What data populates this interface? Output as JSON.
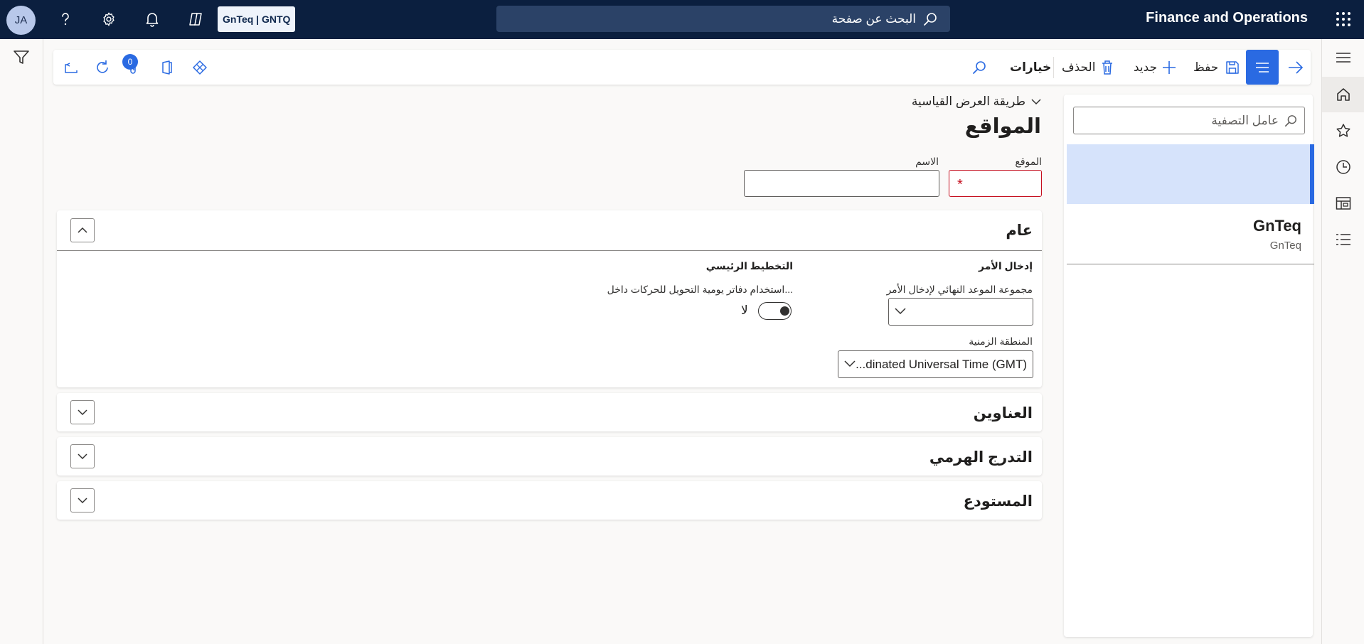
{
  "topbar": {
    "avatar_initials": "JA",
    "company": "GnTeq | GNTQ",
    "search_placeholder": "البحث عن صفحة",
    "app_name": "Finance and Operations"
  },
  "actions": {
    "save": "حفظ",
    "new": "جديد",
    "delete": "الحذف",
    "options": "خيارات",
    "attachments_count": "0"
  },
  "page": {
    "view_name": "طريقة العرض القياسية",
    "title": "المواقع",
    "fields": {
      "site_label": "الموقع",
      "name_label": "الاسم",
      "site_value": "",
      "name_value": ""
    }
  },
  "sections": {
    "general": {
      "title": "عام",
      "order_entry_heading": "إدخال الأمر",
      "deadline_group_label": "مجموعة الموعد النهائي لإدخال الأمر",
      "deadline_group_value": "",
      "timezone_label": "المنطقة الزمنية",
      "timezone_value": "...dinated Universal Time (GMT)",
      "master_planning_heading": "التخطيط الرئيسي",
      "transfer_journals_label": "استخدام دفاتر يومية التحويل للحركات داخل...",
      "transfer_journals_value": "لا"
    },
    "addresses": {
      "title": "العناوين"
    },
    "hierarchy": {
      "title": "التدرج الهرمي"
    },
    "warehouse": {
      "title": "المستودع"
    }
  },
  "list": {
    "filter_placeholder": "عامل التصفية",
    "items": [
      {
        "primary": "",
        "secondary": ""
      },
      {
        "primary": "GnTeq",
        "secondary": "GnTeq"
      }
    ]
  },
  "colors": {
    "topbar": "#0b1f3f",
    "accent": "#2a6ae2",
    "selected_row": "#d6e3fb",
    "required": "#c50f1f"
  },
  "icons": {
    "topbar": [
      "waffle-icon",
      "search-icon",
      "copilot-icon",
      "bell-icon",
      "gear-icon",
      "help-icon"
    ],
    "actionbar": [
      "back-arrow-icon",
      "menu-lines-icon",
      "save-icon",
      "plus-icon",
      "trash-icon",
      "search-icon",
      "power-apps-icon",
      "office-icon",
      "paperclip-icon",
      "refresh-icon",
      "detach-icon"
    ],
    "nav": [
      "hamburger-icon",
      "home-icon",
      "star-icon",
      "clock-icon",
      "workspace-icon",
      "list-icon"
    ]
  }
}
